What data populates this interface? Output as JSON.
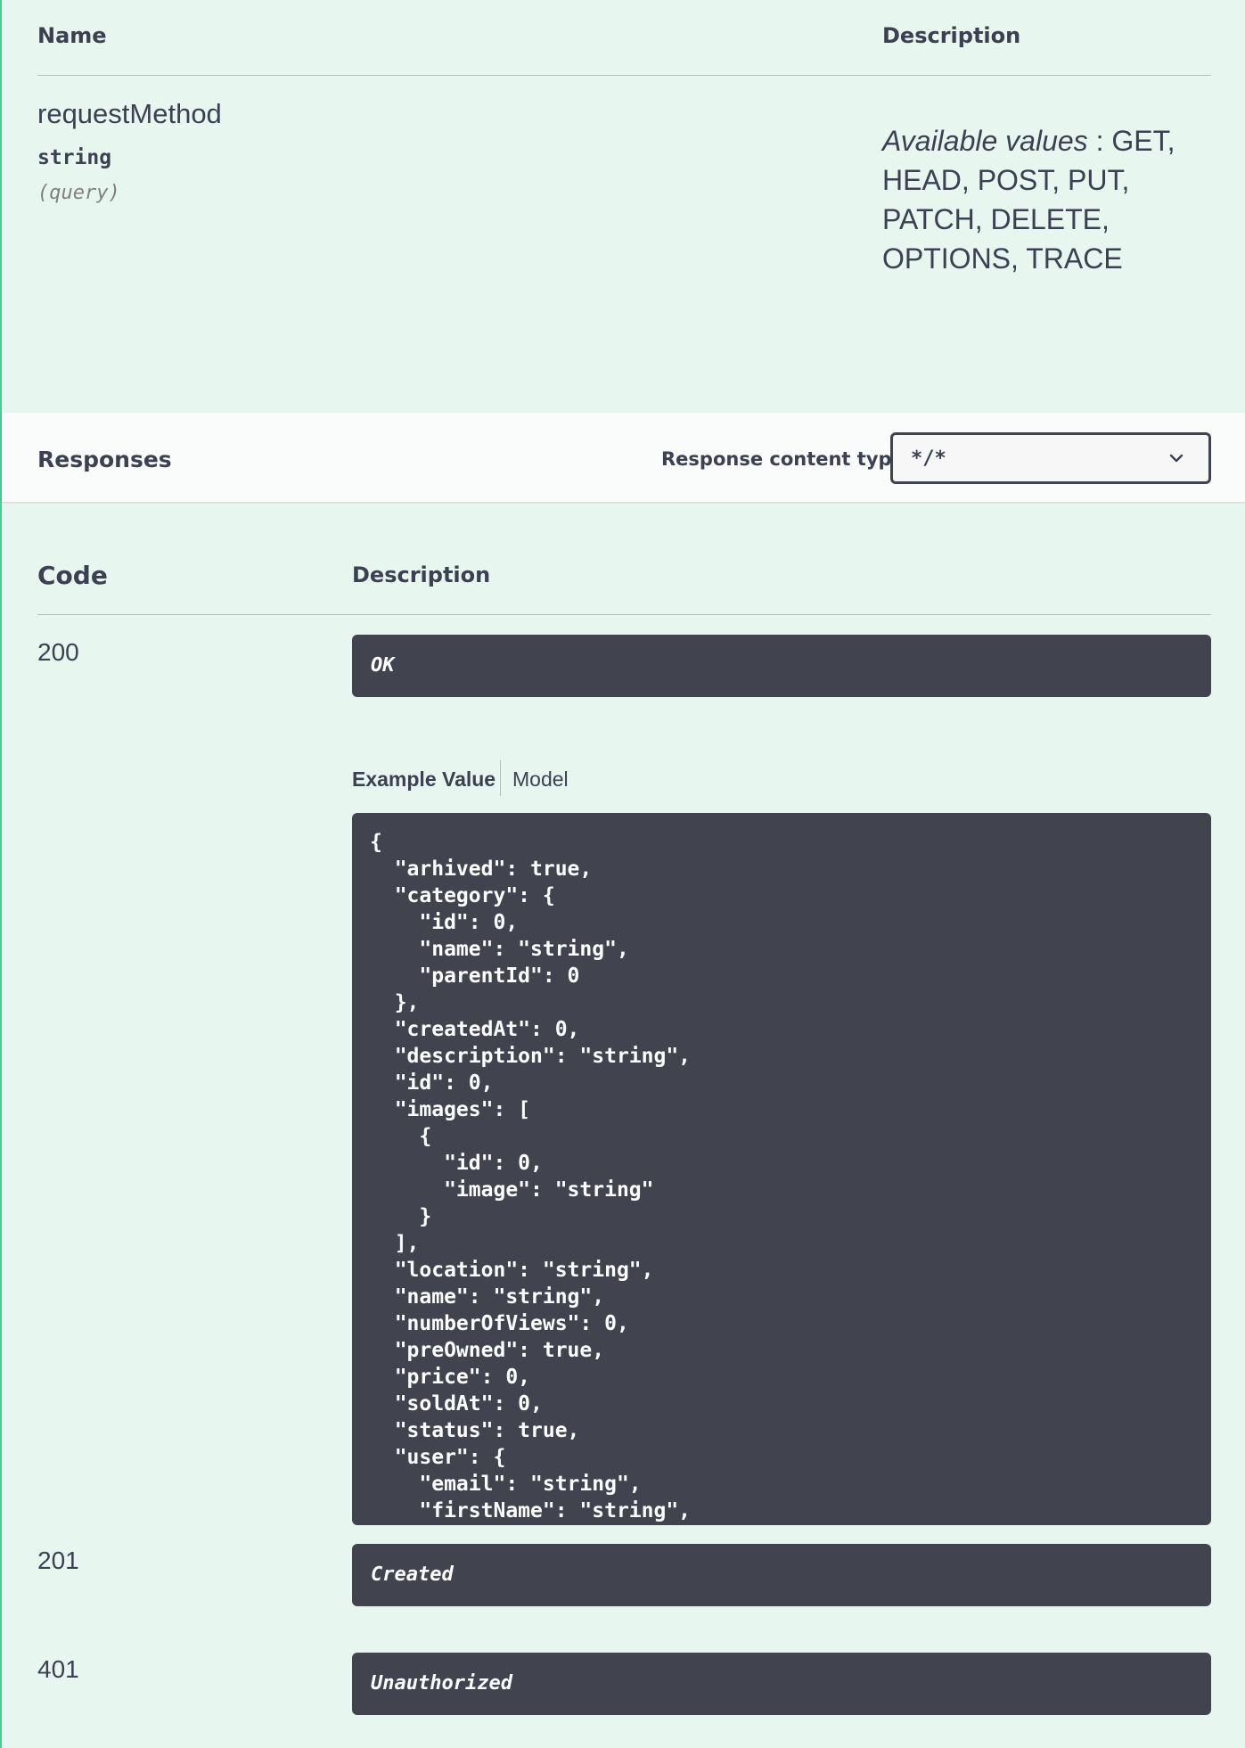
{
  "parameters": {
    "header": {
      "name": "Name",
      "description": "Description"
    },
    "items": [
      {
        "name": "requestMethod",
        "type": "string",
        "in": "(query)",
        "available_label": "Available values",
        "available_values": ": GET, HEAD, POST, PUT, PATCH, DELETE, OPTIONS, TRACE"
      }
    ]
  },
  "responses": {
    "title": "Responses",
    "content_type_label": "Response content type",
    "content_type_value": "*/*",
    "header": {
      "code": "Code",
      "description": "Description"
    },
    "items": [
      {
        "code": "200",
        "description": "OK"
      },
      {
        "code": "201",
        "description": "Created"
      },
      {
        "code": "401",
        "description": "Unauthorized"
      }
    ],
    "example_tabs": {
      "active": "Example Value",
      "other": "Model"
    },
    "example_value": "{\n  \"arhived\": true,\n  \"category\": {\n    \"id\": 0,\n    \"name\": \"string\",\n    \"parentId\": 0\n  },\n  \"createdAt\": 0,\n  \"description\": \"string\",\n  \"id\": 0,\n  \"images\": [\n    {\n      \"id\": 0,\n      \"image\": \"string\"\n    }\n  ],\n  \"location\": \"string\",\n  \"name\": \"string\",\n  \"numberOfViews\": 0,\n  \"preOwned\": true,\n  \"price\": 0,\n  \"soldAt\": 0,\n  \"status\": true,\n  \"user\": {\n    \"email\": \"string\",\n    \"firstName\": \"string\","
  },
  "icons": {
    "select_chevron": "chevron-down-icon"
  },
  "colors": {
    "panel_bg": "#e8f6f0",
    "accent_border": "#49cc90",
    "dark_box": "#41444e",
    "text": "#3b4151"
  }
}
